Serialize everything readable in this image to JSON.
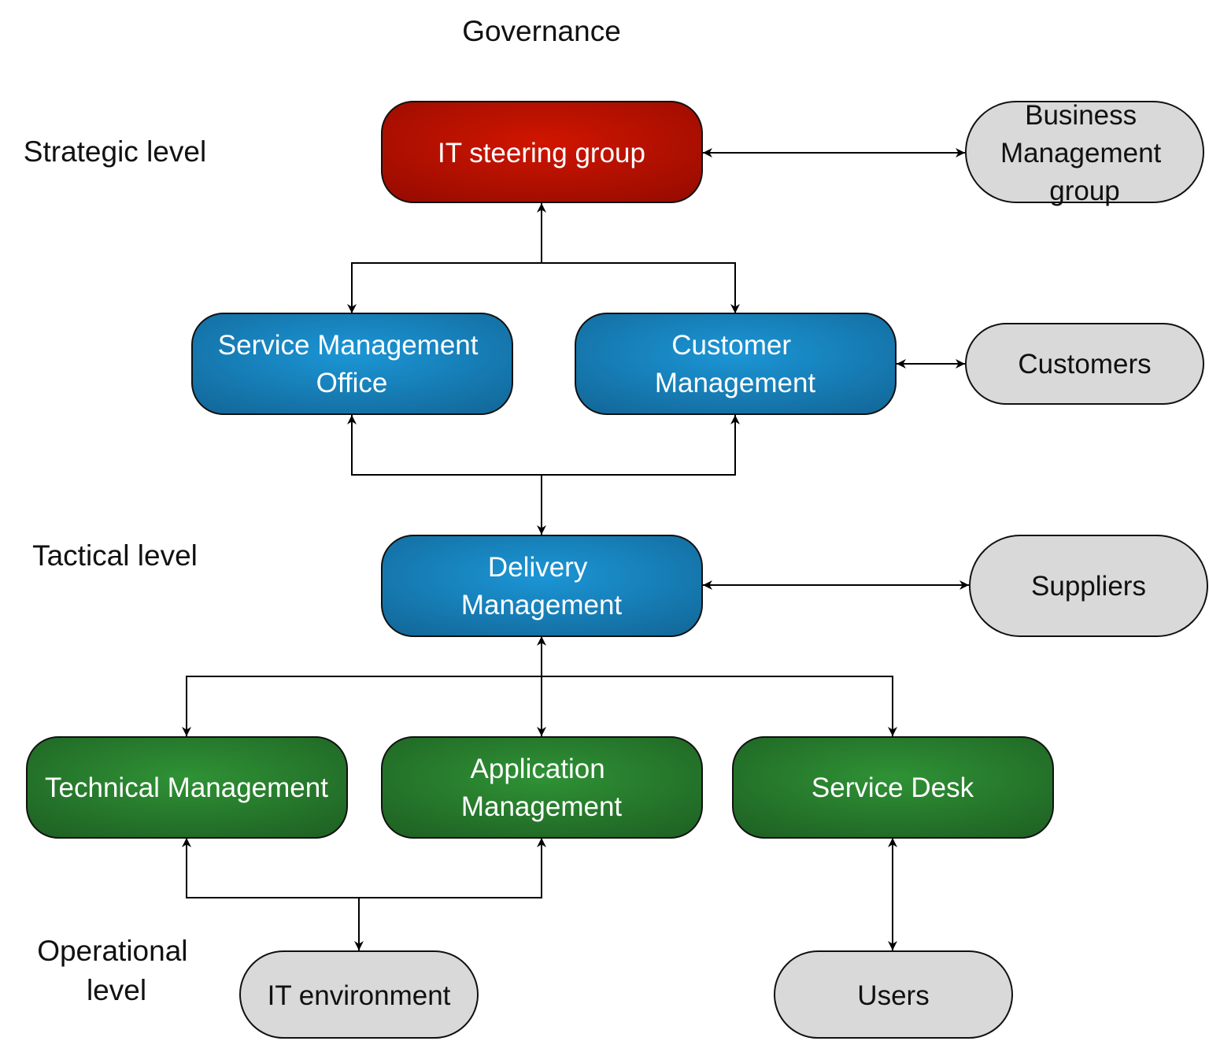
{
  "title": "Governance",
  "levels": {
    "strategic": "Strategic level",
    "tactical": "Tactical level",
    "operational": [
      "Operational",
      "level"
    ]
  },
  "colors": {
    "strategic": "#c41000",
    "tactical": "#1a8fcf",
    "operational": "#2b8a30",
    "external": "#d9d9d9"
  },
  "nodes": {
    "it_steering_group": [
      "IT steering group"
    ],
    "service_management_office": [
      "Service Management",
      "Office"
    ],
    "customer_management": [
      "Customer",
      "Management"
    ],
    "delivery_management": [
      "Delivery",
      "Management"
    ],
    "technical_management": [
      "Technical Management"
    ],
    "application_management": [
      "Application",
      "Management"
    ],
    "service_desk": [
      "Service Desk"
    ],
    "business_management_group": [
      "Business",
      "Management",
      "group"
    ],
    "customers": [
      "Customers"
    ],
    "suppliers": [
      "Suppliers"
    ],
    "it_environment": [
      "IT environment"
    ],
    "users": [
      "Users"
    ]
  }
}
